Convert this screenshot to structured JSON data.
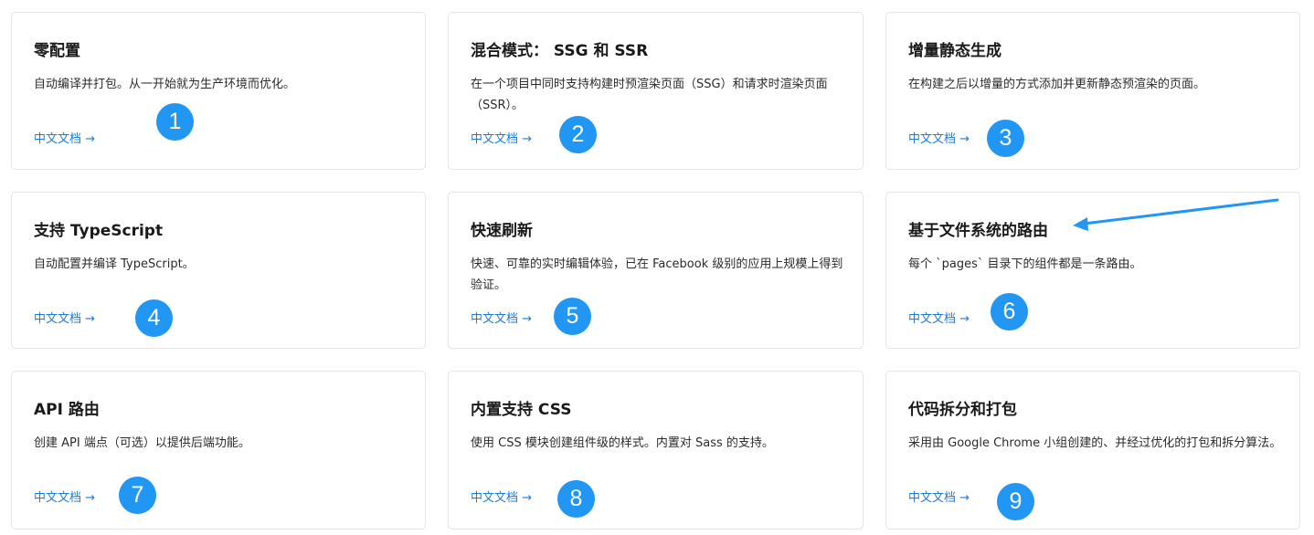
{
  "link_color": "#1f7ad6",
  "badge_color": "#2196f3",
  "annotation_arrow": {
    "color": "#2196f3",
    "icon": "annotation-arrow-icon"
  },
  "cards": [
    {
      "title": "零配置",
      "description": "自动编译并打包。从一开始就为生产环境而优化。",
      "link": "中文文档 →",
      "badge": "1"
    },
    {
      "title": "混合模式： SSG 和 SSR",
      "description": "在一个项目中同时支持构建时预渲染页面（SSG）和请求时渲染页面（SSR）。",
      "link": "中文文档 →",
      "badge": "2"
    },
    {
      "title": "增量静态生成",
      "description": "在构建之后以增量的方式添加并更新静态预渲染的页面。",
      "link": "中文文档 →",
      "badge": "3"
    },
    {
      "title": "支持 TypeScript",
      "description": "自动配置并编译 TypeScript。",
      "link": "中文文档 →",
      "badge": "4"
    },
    {
      "title": "快速刷新",
      "description": "快速、可靠的实时编辑体验，已在 Facebook 级别的应用上规模上得到验证。",
      "link": "中文文档 →",
      "badge": "5"
    },
    {
      "title": "基于文件系统的路由",
      "description": "每个 `pages` 目录下的组件都是一条路由。",
      "link": "中文文档 →",
      "badge": "6"
    },
    {
      "title": "API 路由",
      "description": "创建 API 端点（可选）以提供后端功能。",
      "link": "中文文档 →",
      "badge": "7"
    },
    {
      "title": "内置支持 CSS",
      "description": "使用 CSS 模块创建组件级的样式。内置对 Sass 的支持。",
      "link": "中文文档 →",
      "badge": "8"
    },
    {
      "title": "代码拆分和打包",
      "description": "采用由 Google Chrome 小组创建的、并经过优化的打包和拆分算法。",
      "link": "中文文档 →",
      "badge": "9"
    }
  ]
}
